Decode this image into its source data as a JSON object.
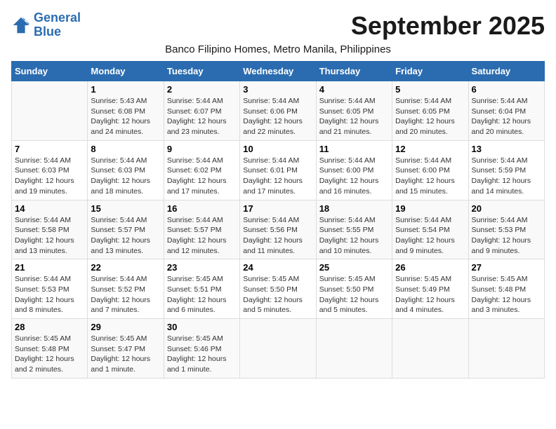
{
  "logo": {
    "line1": "General",
    "line2": "Blue"
  },
  "title": "September 2025",
  "subtitle": "Banco Filipino Homes, Metro Manila, Philippines",
  "days_header": [
    "Sunday",
    "Monday",
    "Tuesday",
    "Wednesday",
    "Thursday",
    "Friday",
    "Saturday"
  ],
  "weeks": [
    [
      {
        "num": "",
        "sunrise": "",
        "sunset": "",
        "daylight": ""
      },
      {
        "num": "1",
        "sunrise": "Sunrise: 5:43 AM",
        "sunset": "Sunset: 6:08 PM",
        "daylight": "Daylight: 12 hours and 24 minutes."
      },
      {
        "num": "2",
        "sunrise": "Sunrise: 5:44 AM",
        "sunset": "Sunset: 6:07 PM",
        "daylight": "Daylight: 12 hours and 23 minutes."
      },
      {
        "num": "3",
        "sunrise": "Sunrise: 5:44 AM",
        "sunset": "Sunset: 6:06 PM",
        "daylight": "Daylight: 12 hours and 22 minutes."
      },
      {
        "num": "4",
        "sunrise": "Sunrise: 5:44 AM",
        "sunset": "Sunset: 6:05 PM",
        "daylight": "Daylight: 12 hours and 21 minutes."
      },
      {
        "num": "5",
        "sunrise": "Sunrise: 5:44 AM",
        "sunset": "Sunset: 6:05 PM",
        "daylight": "Daylight: 12 hours and 20 minutes."
      },
      {
        "num": "6",
        "sunrise": "Sunrise: 5:44 AM",
        "sunset": "Sunset: 6:04 PM",
        "daylight": "Daylight: 12 hours and 20 minutes."
      }
    ],
    [
      {
        "num": "7",
        "sunrise": "Sunrise: 5:44 AM",
        "sunset": "Sunset: 6:03 PM",
        "daylight": "Daylight: 12 hours and 19 minutes."
      },
      {
        "num": "8",
        "sunrise": "Sunrise: 5:44 AM",
        "sunset": "Sunset: 6:03 PM",
        "daylight": "Daylight: 12 hours and 18 minutes."
      },
      {
        "num": "9",
        "sunrise": "Sunrise: 5:44 AM",
        "sunset": "Sunset: 6:02 PM",
        "daylight": "Daylight: 12 hours and 17 minutes."
      },
      {
        "num": "10",
        "sunrise": "Sunrise: 5:44 AM",
        "sunset": "Sunset: 6:01 PM",
        "daylight": "Daylight: 12 hours and 17 minutes."
      },
      {
        "num": "11",
        "sunrise": "Sunrise: 5:44 AM",
        "sunset": "Sunset: 6:00 PM",
        "daylight": "Daylight: 12 hours and 16 minutes."
      },
      {
        "num": "12",
        "sunrise": "Sunrise: 5:44 AM",
        "sunset": "Sunset: 6:00 PM",
        "daylight": "Daylight: 12 hours and 15 minutes."
      },
      {
        "num": "13",
        "sunrise": "Sunrise: 5:44 AM",
        "sunset": "Sunset: 5:59 PM",
        "daylight": "Daylight: 12 hours and 14 minutes."
      }
    ],
    [
      {
        "num": "14",
        "sunrise": "Sunrise: 5:44 AM",
        "sunset": "Sunset: 5:58 PM",
        "daylight": "Daylight: 12 hours and 13 minutes."
      },
      {
        "num": "15",
        "sunrise": "Sunrise: 5:44 AM",
        "sunset": "Sunset: 5:57 PM",
        "daylight": "Daylight: 12 hours and 13 minutes."
      },
      {
        "num": "16",
        "sunrise": "Sunrise: 5:44 AM",
        "sunset": "Sunset: 5:57 PM",
        "daylight": "Daylight: 12 hours and 12 minutes."
      },
      {
        "num": "17",
        "sunrise": "Sunrise: 5:44 AM",
        "sunset": "Sunset: 5:56 PM",
        "daylight": "Daylight: 12 hours and 11 minutes."
      },
      {
        "num": "18",
        "sunrise": "Sunrise: 5:44 AM",
        "sunset": "Sunset: 5:55 PM",
        "daylight": "Daylight: 12 hours and 10 minutes."
      },
      {
        "num": "19",
        "sunrise": "Sunrise: 5:44 AM",
        "sunset": "Sunset: 5:54 PM",
        "daylight": "Daylight: 12 hours and 9 minutes."
      },
      {
        "num": "20",
        "sunrise": "Sunrise: 5:44 AM",
        "sunset": "Sunset: 5:53 PM",
        "daylight": "Daylight: 12 hours and 9 minutes."
      }
    ],
    [
      {
        "num": "21",
        "sunrise": "Sunrise: 5:44 AM",
        "sunset": "Sunset: 5:53 PM",
        "daylight": "Daylight: 12 hours and 8 minutes."
      },
      {
        "num": "22",
        "sunrise": "Sunrise: 5:44 AM",
        "sunset": "Sunset: 5:52 PM",
        "daylight": "Daylight: 12 hours and 7 minutes."
      },
      {
        "num": "23",
        "sunrise": "Sunrise: 5:45 AM",
        "sunset": "Sunset: 5:51 PM",
        "daylight": "Daylight: 12 hours and 6 minutes."
      },
      {
        "num": "24",
        "sunrise": "Sunrise: 5:45 AM",
        "sunset": "Sunset: 5:50 PM",
        "daylight": "Daylight: 12 hours and 5 minutes."
      },
      {
        "num": "25",
        "sunrise": "Sunrise: 5:45 AM",
        "sunset": "Sunset: 5:50 PM",
        "daylight": "Daylight: 12 hours and 5 minutes."
      },
      {
        "num": "26",
        "sunrise": "Sunrise: 5:45 AM",
        "sunset": "Sunset: 5:49 PM",
        "daylight": "Daylight: 12 hours and 4 minutes."
      },
      {
        "num": "27",
        "sunrise": "Sunrise: 5:45 AM",
        "sunset": "Sunset: 5:48 PM",
        "daylight": "Daylight: 12 hours and 3 minutes."
      }
    ],
    [
      {
        "num": "28",
        "sunrise": "Sunrise: 5:45 AM",
        "sunset": "Sunset: 5:48 PM",
        "daylight": "Daylight: 12 hours and 2 minutes."
      },
      {
        "num": "29",
        "sunrise": "Sunrise: 5:45 AM",
        "sunset": "Sunset: 5:47 PM",
        "daylight": "Daylight: 12 hours and 1 minute."
      },
      {
        "num": "30",
        "sunrise": "Sunrise: 5:45 AM",
        "sunset": "Sunset: 5:46 PM",
        "daylight": "Daylight: 12 hours and 1 minute."
      },
      {
        "num": "",
        "sunrise": "",
        "sunset": "",
        "daylight": ""
      },
      {
        "num": "",
        "sunrise": "",
        "sunset": "",
        "daylight": ""
      },
      {
        "num": "",
        "sunrise": "",
        "sunset": "",
        "daylight": ""
      },
      {
        "num": "",
        "sunrise": "",
        "sunset": "",
        "daylight": ""
      }
    ]
  ]
}
